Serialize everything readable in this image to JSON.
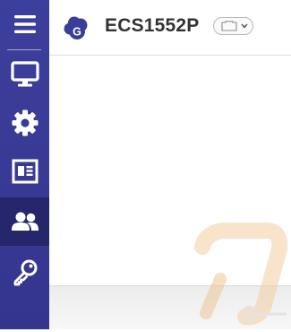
{
  "header": {
    "device_name": "ECS1552P",
    "brand_logo_letter": "G"
  },
  "sidebar": {
    "items": [
      {
        "name": "menu",
        "icon": "hamburger-icon",
        "active": false
      },
      {
        "name": "monitor",
        "icon": "monitor-icon",
        "active": false
      },
      {
        "name": "settings",
        "icon": "gear-icon",
        "active": false
      },
      {
        "name": "dashboard",
        "icon": "newspaper-icon",
        "active": false
      },
      {
        "name": "accounts",
        "icon": "users-icon",
        "active": true
      },
      {
        "name": "security",
        "icon": "key-icon",
        "active": false
      }
    ]
  },
  "colors": {
    "sidebar": "#3d3f9c",
    "sidebar_active": "#25266b",
    "brand": "#3b3d9a",
    "text": "#333333"
  }
}
